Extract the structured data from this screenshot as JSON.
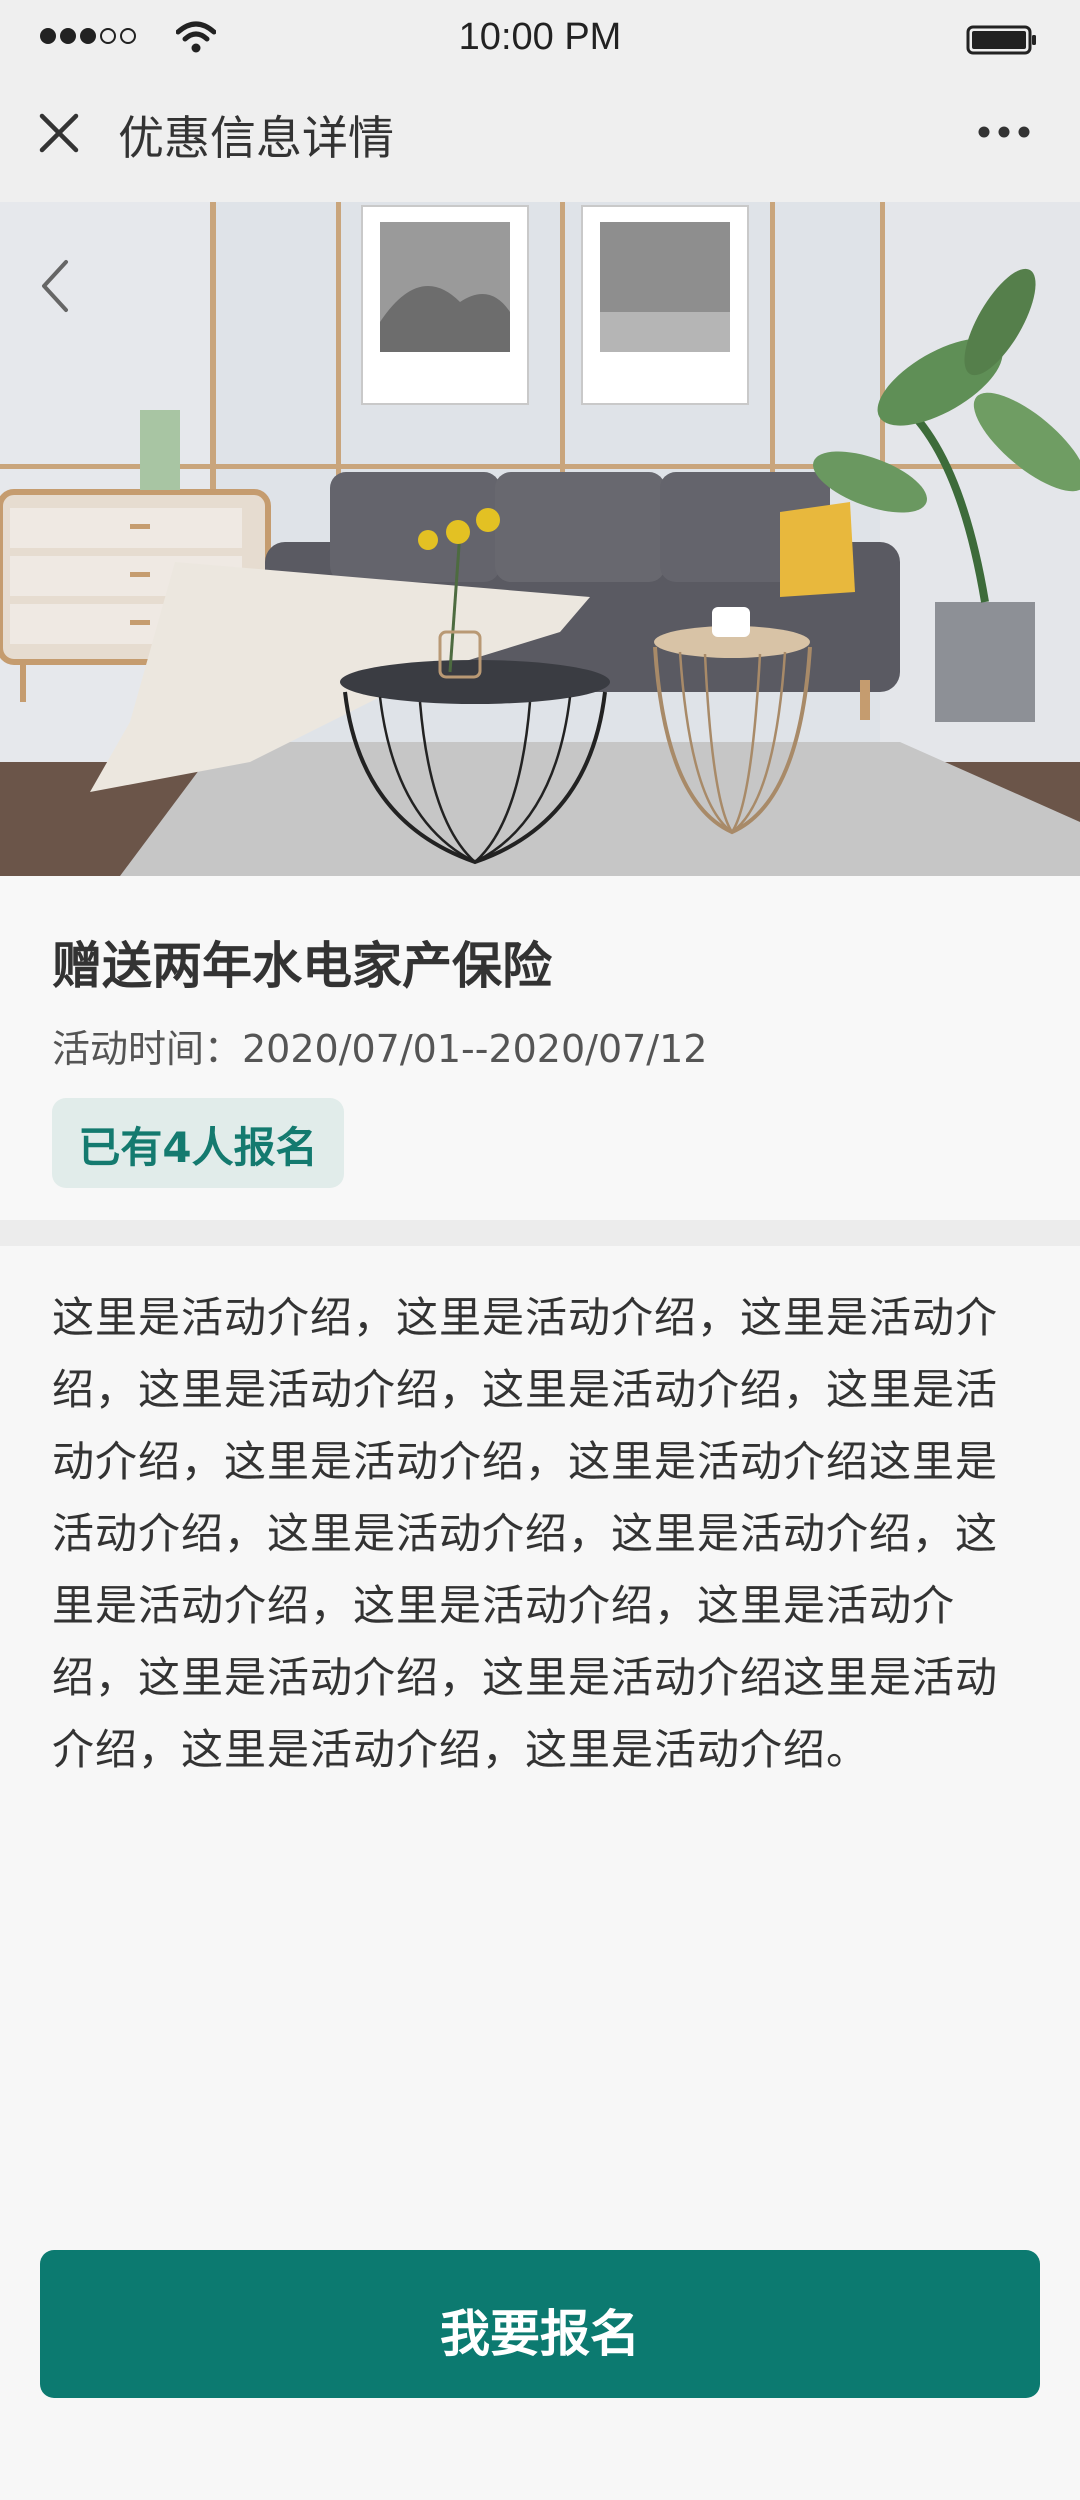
{
  "status_bar": {
    "time": "10:00 PM",
    "signal_icon": "signal-icon",
    "wifi_icon": "wifi-icon",
    "battery_icon": "battery-icon"
  },
  "nav": {
    "title": "优惠信息详情",
    "close_icon": "close-icon",
    "more_icon": "more-icon"
  },
  "hero": {
    "image": "living-room-photo",
    "back_icon": "chevron-left-icon"
  },
  "promo": {
    "title": "赠送两年水电家产保险",
    "time": "活动时间：2020/07/01--2020/07/12",
    "signup_count": "已有4人报名"
  },
  "description": "这里是活动介绍，这里是活动介绍，这里是活动介绍，这里是活动介绍，这里是活动介绍，这里是活动介绍，这里是活动介绍，这里是活动介绍这里是活动介绍，这里是活动介绍，这里是活动介绍，这里是活动介绍，这里是活动介绍，这里是活动介绍，这里是活动介绍，这里是活动介绍这里是活动介绍，这里是活动介绍，这里是活动介绍。",
  "signup_button": "我要报名",
  "colors": {
    "accent": "#0c7a70",
    "badge_bg": "#e1ecea",
    "badge_text": "#147a6f",
    "background": "#f7f7f7"
  }
}
